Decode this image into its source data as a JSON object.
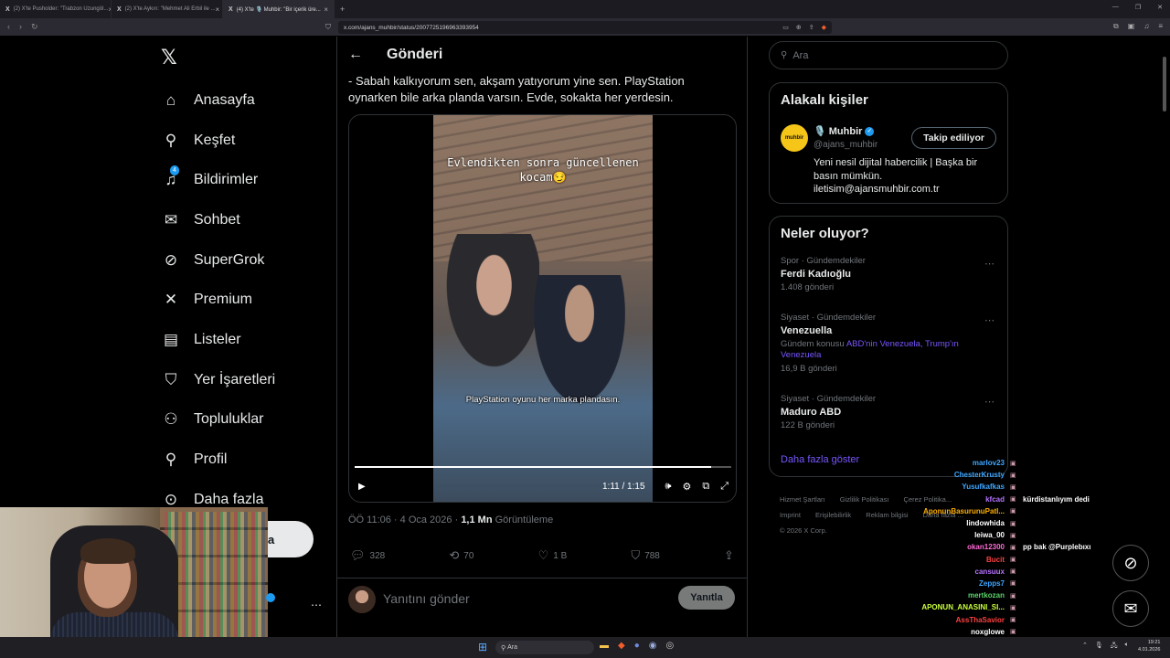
{
  "browser": {
    "tabs": [
      {
        "label": "(2) X'te Pusholder: \"Trabzon Uzungöl...",
        "active": false
      },
      {
        "label": "(2) X'te Aykırı: \"Mehmet Ali Erbil ile ...",
        "active": false
      },
      {
        "label": "(4) X'te 🎙️ Muhbir: \"Bir içerik üre...",
        "active": true
      }
    ],
    "url": "x.com/ajans_muhbir/status/2007725196963393954"
  },
  "sidebar": {
    "notification_count": "4",
    "items": [
      {
        "label": "Anasayfa",
        "icon": "home-icon",
        "glyph": "⌂"
      },
      {
        "label": "Keşfet",
        "icon": "search-icon",
        "glyph": "⚲"
      },
      {
        "label": "Bildirimler",
        "icon": "bell-icon",
        "glyph": "🔔"
      },
      {
        "label": "Sohbet",
        "icon": "mail-icon",
        "glyph": "✉"
      },
      {
        "label": "SuperGrok",
        "icon": "grok-icon",
        "glyph": "⊘"
      },
      {
        "label": "Premium",
        "icon": "x-premium-icon",
        "glyph": "𝕏"
      },
      {
        "label": "Listeler",
        "icon": "list-icon",
        "glyph": "☰"
      },
      {
        "label": "Yer İşaretleri",
        "icon": "bookmark-icon",
        "glyph": "🔖"
      },
      {
        "label": "Topluluklar",
        "icon": "communities-icon",
        "glyph": "👥"
      },
      {
        "label": "Profil",
        "icon": "profile-icon",
        "glyph": "👤"
      },
      {
        "label": "Daha fazla",
        "icon": "more-icon",
        "glyph": "⋯"
      }
    ],
    "post_button_partial": "a"
  },
  "post": {
    "header": "Gönderi",
    "text": "- Sabah kalkıyorum sen, akşam yatıyorum yine sen. PlayStation oynarken bile arka planda varsın. Evde, sokakta her yerdesin.",
    "video": {
      "caption_top": "Evlendikten sonra güncellenen kocam😏",
      "caption_bottom": "PlayStation oyunu her marka plandasın.",
      "time": "1:11 / 1:15",
      "progress": 0.946
    },
    "meta_time": "ÖÖ 11:06 · 4 Oca 2026 · ",
    "views": "1,1 Mn",
    "views_label": " Görüntüleme",
    "stats": {
      "replies": "328",
      "reposts": "70",
      "likes": "1 B",
      "bookmarks": "788"
    },
    "reply_placeholder": "Yanıtını gönder",
    "reply_button": "Yanıtla"
  },
  "right": {
    "search_placeholder": "Ara",
    "related_title": "Alakalı kişiler",
    "account": {
      "name": "🎙️ Muhbir",
      "handle": "@ajans_muhbir",
      "avatar_text": "muhbir",
      "follow_label": "Takip ediliyor",
      "bio": "Yeni nesil dijital habercilik | Başka bir basın mümkün. iletisim@ajansmuhbir.com.tr"
    },
    "trends_title": "Neler oluyor?",
    "trends": [
      {
        "category": "Spor · Gündemdekiler",
        "name": "Ferdi Kadıoğlu",
        "context_prefix": "",
        "context_link": "",
        "count": "1.408 gönderi"
      },
      {
        "category": "Siyaset · Gündemdekiler",
        "name": "Venezuella",
        "context_prefix": "Gündem konusu ",
        "context_link": "ABD'nin Venezuela, Trump'ın Venezuela",
        "count": "16,9 B gönderi"
      },
      {
        "category": "Siyaset · Gündemdekiler",
        "name": "Maduro ABD",
        "context_prefix": "",
        "context_link": "",
        "count": "122 B gönderi"
      }
    ],
    "show_more": "Daha fazla göster",
    "footer": {
      "links1": [
        "Hizmet Şartları",
        "Gizlilik Politikası",
        "Çerez Politika..."
      ],
      "links2": [
        "Imprint",
        "Erişilebilirlik",
        "Reklam bilgisi",
        "Daha fazla ..."
      ],
      "copyright": "© 2026 X Corp."
    }
  },
  "chat": [
    {
      "user": "marlov23",
      "color": "#3ea6ff",
      "text": ""
    },
    {
      "user": "ChesterKrusty",
      "color": "#3ea6ff",
      "text": ""
    },
    {
      "user": "Yusufkafkas",
      "color": "#3ea6ff",
      "text": ""
    },
    {
      "user": "kfcad",
      "color": "#b673ff",
      "text": "kürdistanlıyım dedi"
    },
    {
      "user": "AponunBasurunuPatl...",
      "color": "#ffb000",
      "text": ""
    },
    {
      "user": "lindowhida",
      "color": "#ffffff",
      "text": ""
    },
    {
      "user": "leiwa_00",
      "color": "#ffffff",
      "text": ""
    },
    {
      "user": "okan12300",
      "color": "#ff6ad5",
      "text": "pp bak @Purplebıxı"
    },
    {
      "user": "Bucit",
      "color": "#ff4040",
      "text": ""
    },
    {
      "user": "cansuux",
      "color": "#b673ff",
      "text": ""
    },
    {
      "user": "Zepps7",
      "color": "#3ea6ff",
      "text": ""
    },
    {
      "user": "mertkozan",
      "color": "#5bd46a",
      "text": ""
    },
    {
      "user": "APONUN_ANASINI_SI...",
      "color": "#c8ff3a",
      "text": ""
    },
    {
      "user": "AssThaSavior",
      "color": "#ff4040",
      "text": ""
    },
    {
      "user": "noxglowe",
      "color": "#ffffff",
      "text": ""
    }
  ],
  "taskbar": {
    "search": "Ara",
    "time": "19:21",
    "date": "4.01.2026"
  }
}
